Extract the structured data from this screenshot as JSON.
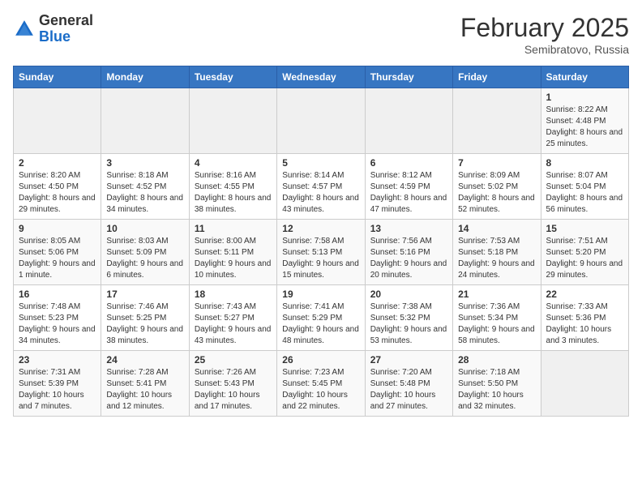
{
  "logo": {
    "general": "General",
    "blue": "Blue"
  },
  "header": {
    "month_year": "February 2025",
    "location": "Semibratovo, Russia"
  },
  "weekdays": [
    "Sunday",
    "Monday",
    "Tuesday",
    "Wednesday",
    "Thursday",
    "Friday",
    "Saturday"
  ],
  "weeks": [
    [
      {
        "day": "",
        "info": ""
      },
      {
        "day": "",
        "info": ""
      },
      {
        "day": "",
        "info": ""
      },
      {
        "day": "",
        "info": ""
      },
      {
        "day": "",
        "info": ""
      },
      {
        "day": "",
        "info": ""
      },
      {
        "day": "1",
        "info": "Sunrise: 8:22 AM\nSunset: 4:48 PM\nDaylight: 8 hours and 25 minutes."
      }
    ],
    [
      {
        "day": "2",
        "info": "Sunrise: 8:20 AM\nSunset: 4:50 PM\nDaylight: 8 hours and 29 minutes."
      },
      {
        "day": "3",
        "info": "Sunrise: 8:18 AM\nSunset: 4:52 PM\nDaylight: 8 hours and 34 minutes."
      },
      {
        "day": "4",
        "info": "Sunrise: 8:16 AM\nSunset: 4:55 PM\nDaylight: 8 hours and 38 minutes."
      },
      {
        "day": "5",
        "info": "Sunrise: 8:14 AM\nSunset: 4:57 PM\nDaylight: 8 hours and 43 minutes."
      },
      {
        "day": "6",
        "info": "Sunrise: 8:12 AM\nSunset: 4:59 PM\nDaylight: 8 hours and 47 minutes."
      },
      {
        "day": "7",
        "info": "Sunrise: 8:09 AM\nSunset: 5:02 PM\nDaylight: 8 hours and 52 minutes."
      },
      {
        "day": "8",
        "info": "Sunrise: 8:07 AM\nSunset: 5:04 PM\nDaylight: 8 hours and 56 minutes."
      }
    ],
    [
      {
        "day": "9",
        "info": "Sunrise: 8:05 AM\nSunset: 5:06 PM\nDaylight: 9 hours and 1 minute."
      },
      {
        "day": "10",
        "info": "Sunrise: 8:03 AM\nSunset: 5:09 PM\nDaylight: 9 hours and 6 minutes."
      },
      {
        "day": "11",
        "info": "Sunrise: 8:00 AM\nSunset: 5:11 PM\nDaylight: 9 hours and 10 minutes."
      },
      {
        "day": "12",
        "info": "Sunrise: 7:58 AM\nSunset: 5:13 PM\nDaylight: 9 hours and 15 minutes."
      },
      {
        "day": "13",
        "info": "Sunrise: 7:56 AM\nSunset: 5:16 PM\nDaylight: 9 hours and 20 minutes."
      },
      {
        "day": "14",
        "info": "Sunrise: 7:53 AM\nSunset: 5:18 PM\nDaylight: 9 hours and 24 minutes."
      },
      {
        "day": "15",
        "info": "Sunrise: 7:51 AM\nSunset: 5:20 PM\nDaylight: 9 hours and 29 minutes."
      }
    ],
    [
      {
        "day": "16",
        "info": "Sunrise: 7:48 AM\nSunset: 5:23 PM\nDaylight: 9 hours and 34 minutes."
      },
      {
        "day": "17",
        "info": "Sunrise: 7:46 AM\nSunset: 5:25 PM\nDaylight: 9 hours and 38 minutes."
      },
      {
        "day": "18",
        "info": "Sunrise: 7:43 AM\nSunset: 5:27 PM\nDaylight: 9 hours and 43 minutes."
      },
      {
        "day": "19",
        "info": "Sunrise: 7:41 AM\nSunset: 5:29 PM\nDaylight: 9 hours and 48 minutes."
      },
      {
        "day": "20",
        "info": "Sunrise: 7:38 AM\nSunset: 5:32 PM\nDaylight: 9 hours and 53 minutes."
      },
      {
        "day": "21",
        "info": "Sunrise: 7:36 AM\nSunset: 5:34 PM\nDaylight: 9 hours and 58 minutes."
      },
      {
        "day": "22",
        "info": "Sunrise: 7:33 AM\nSunset: 5:36 PM\nDaylight: 10 hours and 3 minutes."
      }
    ],
    [
      {
        "day": "23",
        "info": "Sunrise: 7:31 AM\nSunset: 5:39 PM\nDaylight: 10 hours and 7 minutes."
      },
      {
        "day": "24",
        "info": "Sunrise: 7:28 AM\nSunset: 5:41 PM\nDaylight: 10 hours and 12 minutes."
      },
      {
        "day": "25",
        "info": "Sunrise: 7:26 AM\nSunset: 5:43 PM\nDaylight: 10 hours and 17 minutes."
      },
      {
        "day": "26",
        "info": "Sunrise: 7:23 AM\nSunset: 5:45 PM\nDaylight: 10 hours and 22 minutes."
      },
      {
        "day": "27",
        "info": "Sunrise: 7:20 AM\nSunset: 5:48 PM\nDaylight: 10 hours and 27 minutes."
      },
      {
        "day": "28",
        "info": "Sunrise: 7:18 AM\nSunset: 5:50 PM\nDaylight: 10 hours and 32 minutes."
      },
      {
        "day": "",
        "info": ""
      }
    ]
  ]
}
